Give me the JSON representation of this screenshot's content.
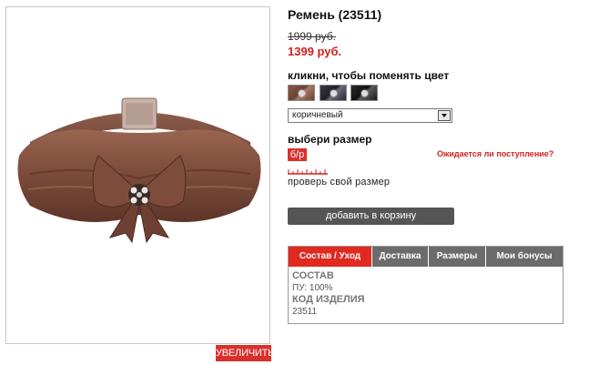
{
  "product": {
    "title": "Ремень (23511)",
    "old_price": "1999 руб.",
    "new_price": "1399 руб.",
    "image_alt": "belt-photo"
  },
  "zoom_label": "УВЕЛИЧИТЬ",
  "colors": {
    "label": "кликни, чтобы поменять цвет",
    "selected": "коричневый"
  },
  "size": {
    "label": "выбери размер",
    "options": [
      "б/р"
    ],
    "arrival_link": "Ожидается ли поступление?",
    "check_size": "проверь свой размер"
  },
  "cart": {
    "button": "добавить в корзину"
  },
  "tabs": {
    "items": [
      "Состав / Уход",
      "Доставка",
      "Размеры",
      "Мои бонусы"
    ],
    "active": 0,
    "content": {
      "composition_title": "СОСТАВ",
      "composition_value": "ПУ: 100%",
      "code_title": "КОД ИЗДЕЛИЯ",
      "code_value": "23511"
    }
  },
  "accent_colors": {
    "red": "#d9302c",
    "dark_button": "#555555",
    "tab_inactive": "#6b6b6b"
  }
}
